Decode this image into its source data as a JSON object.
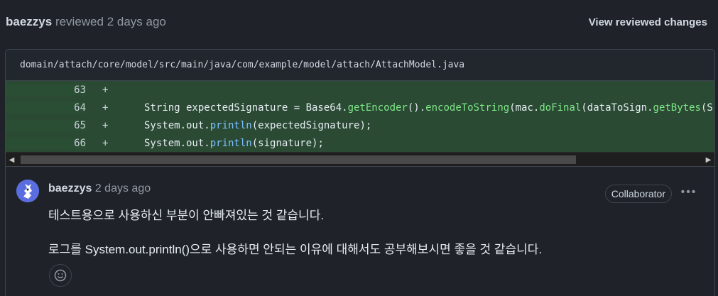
{
  "review": {
    "author": "baezzys",
    "action": "reviewed 2 days ago",
    "view_changes": "View reviewed changes"
  },
  "file": {
    "path": "domain/attach/core/model/src/main/java/com/example/model/attach/AttachModel.java"
  },
  "diff": {
    "lines": [
      {
        "num": "63",
        "sign": "+",
        "parts": [
          {
            "t": "",
            "c": ""
          }
        ]
      },
      {
        "num": "64",
        "sign": "+",
        "parts": [
          {
            "t": "String expectedSignature = Base64.",
            "c": ""
          },
          {
            "t": "getEncoder",
            "c": "tok-fn"
          },
          {
            "t": "().",
            "c": ""
          },
          {
            "t": "encodeToString",
            "c": "tok-fn"
          },
          {
            "t": "(mac.",
            "c": ""
          },
          {
            "t": "doFinal",
            "c": "tok-fn"
          },
          {
            "t": "(dataToSign.",
            "c": ""
          },
          {
            "t": "getBytes",
            "c": "tok-fn"
          },
          {
            "t": "(S",
            "c": ""
          }
        ]
      },
      {
        "num": "65",
        "sign": "+",
        "parts": [
          {
            "t": "System.out.",
            "c": ""
          },
          {
            "t": "println",
            "c": "tok-fn2"
          },
          {
            "t": "(expectedSignature);",
            "c": ""
          }
        ]
      },
      {
        "num": "66",
        "sign": "+",
        "parts": [
          {
            "t": "System.out.",
            "c": ""
          },
          {
            "t": "println",
            "c": "tok-fn2"
          },
          {
            "t": "(signature);",
            "c": ""
          }
        ]
      }
    ]
  },
  "comment": {
    "author": "baezzys",
    "time": "2 days ago",
    "badge": "Collaborator",
    "more": "•••",
    "paragraphs": [
      "테스트용으로 사용하신 부분이 안빠져있는 것 같습니다.",
      "로그를 System.out.println()으로 사용하면 안되는 이유에 대해서도 공부해보시면 좋을 것 같습니다."
    ]
  },
  "icons": {
    "avatar": "avatar-icon",
    "reaction": "smiley-icon",
    "scroll_left": "scroll-left-arrow-icon",
    "scroll_right": "scroll-right-arrow-icon"
  },
  "colors": {
    "background": "#1f2329",
    "diff_added": "#2b4a34",
    "accent_green": "#7ee787",
    "accent_blue": "#79c0ff",
    "avatar": "#5b6ee0"
  }
}
